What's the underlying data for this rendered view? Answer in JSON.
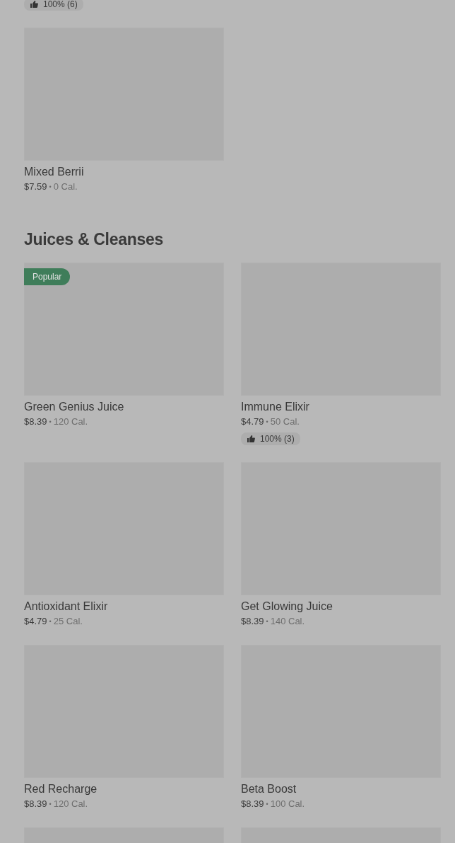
{
  "top_rating": {
    "text": "100% (6)"
  },
  "top_items": [
    {
      "name": "Mixed Berrii",
      "price": "$7.59",
      "separator": "•",
      "calories": "0 Cal."
    }
  ],
  "section": {
    "title": "Juices & Cleanses",
    "items": [
      {
        "kind": "item",
        "name": "Green Genius Juice",
        "price": "$8.39",
        "separator": "•",
        "calories": "120 Cal.",
        "tag": "Popular"
      },
      {
        "kind": "item",
        "name": "Immune Elixir",
        "price": "$4.79",
        "separator": "•",
        "calories": "50 Cal.",
        "rating": "100% (3)"
      },
      {
        "kind": "item",
        "name": "Antioxidant Elixir",
        "price": "$4.79",
        "separator": "•",
        "calories": "25 Cal."
      },
      {
        "kind": "item",
        "name": "Get Glowing Juice",
        "price": "$8.39",
        "separator": "•",
        "calories": "140 Cal."
      },
      {
        "kind": "item",
        "name": "Red Recharge",
        "price": "$8.39",
        "separator": "•",
        "calories": "120 Cal."
      },
      {
        "kind": "item",
        "name": "Beta Boost",
        "price": "$8.39",
        "separator": "•",
        "calories": "100 Cal."
      },
      {
        "kind": "picture"
      },
      {
        "kind": "picture"
      }
    ]
  }
}
